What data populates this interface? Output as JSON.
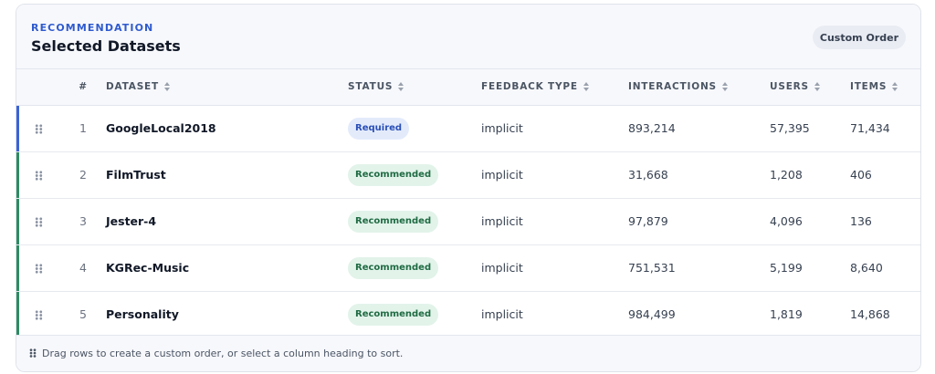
{
  "header": {
    "eyebrow": "RECOMMENDATION",
    "title": "Selected Datasets",
    "custom_order_label": "Custom Order"
  },
  "columns": {
    "num": "#",
    "dataset": "DATASET",
    "status": "STATUS",
    "feedback_type": "FEEDBACK TYPE",
    "interactions": "INTERACTIONS",
    "users": "USERS",
    "items": "ITEMS"
  },
  "rows": [
    {
      "num": "1",
      "dataset": "GoogleLocal2018",
      "status": "Required",
      "feedback_type": "implicit",
      "interactions": "893,214",
      "users": "57,395",
      "items": "71,434"
    },
    {
      "num": "2",
      "dataset": "FilmTrust",
      "status": "Recommended",
      "feedback_type": "implicit",
      "interactions": "31,668",
      "users": "1,208",
      "items": "406"
    },
    {
      "num": "3",
      "dataset": "Jester-4",
      "status": "Recommended",
      "feedback_type": "implicit",
      "interactions": "97,879",
      "users": "4,096",
      "items": "136"
    },
    {
      "num": "4",
      "dataset": "KGRec-Music",
      "status": "Recommended",
      "feedback_type": "implicit",
      "interactions": "751,531",
      "users": "5,199",
      "items": "8,640"
    },
    {
      "num": "5",
      "dataset": "Personality",
      "status": "Recommended",
      "feedback_type": "implicit",
      "interactions": "984,499",
      "users": "1,819",
      "items": "14,868"
    }
  ],
  "footer": {
    "hint": "Drag rows to create a custom order, or select a column heading to sort."
  },
  "colors": {
    "accent": "#2f5bcf",
    "required_bar": "#3b63d6",
    "recommended_bar": "#2e8b63",
    "required_badge_bg": "#e3ebfb",
    "required_badge_text": "#2a4fb8",
    "recommended_badge_bg": "#e2f3ea",
    "recommended_badge_text": "#1f6b43"
  },
  "icons": {
    "row_handle": "drag-handle-icon",
    "sort": "sort-icon"
  }
}
